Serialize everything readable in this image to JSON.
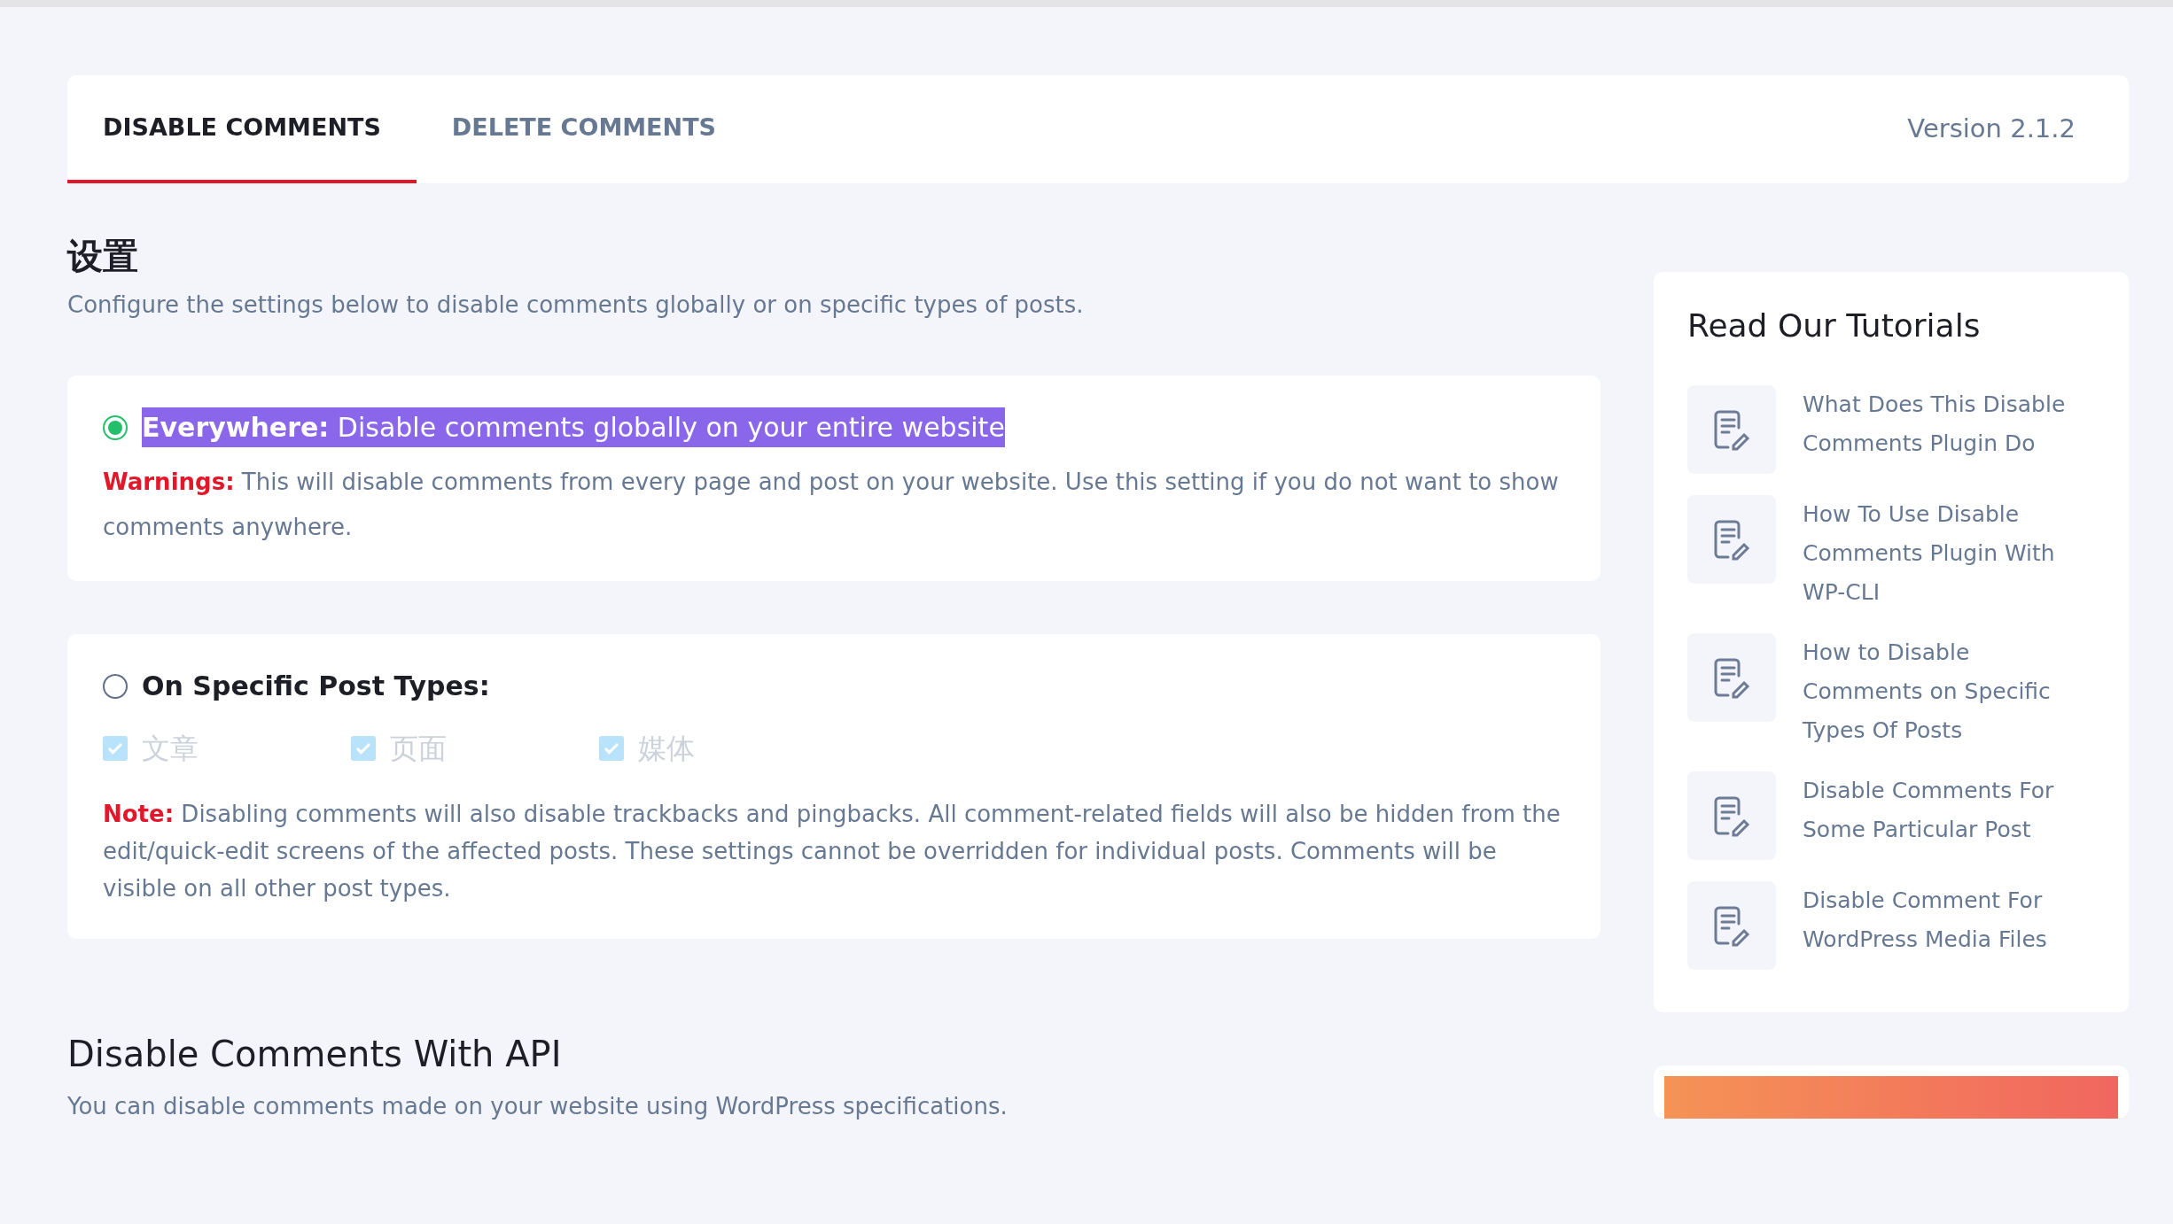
{
  "tabs": [
    {
      "label": "DISABLE COMMENTS",
      "selected": true
    },
    {
      "label": "DELETE COMMENTS",
      "selected": false
    }
  ],
  "version": "Version 2.1.2",
  "settings": {
    "title": "设置",
    "description": "Configure the settings below to disable comments globally or on specific types of posts."
  },
  "options": [
    {
      "kind": "everywhere",
      "selected": true,
      "highlighted": true,
      "label": "**Everywhere:** Disable comments globally on your entire website",
      "warning_label": "Warnings:",
      "warning_text": "This will disable comments from every page and post on your website. Use this setting if you do not want to show comments anywhere."
    },
    {
      "kind": "post_types",
      "selected": false,
      "highlighted": false,
      "label": "On Specific Post Types:",
      "post_types": [
        {
          "label": "文章",
          "checked": true,
          "disabled": true
        },
        {
          "label": "页面",
          "checked": true,
          "disabled": true
        },
        {
          "label": "媒体",
          "checked": true,
          "disabled": true
        }
      ],
      "note_label": "Note:",
      "note_text": "Disabling comments will also disable trackbacks and pingbacks. All comment-related fields will also be hidden from the edit/quick-edit screens of the affected posts. These settings cannot be overridden for individual posts. Comments will be visible on all other post types."
    }
  ],
  "api": {
    "title": "Disable Comments With API",
    "description": "You can disable comments made on your website using WordPress specifications."
  },
  "tutorials": {
    "title": "Read Our Tutorials",
    "items": [
      "What Does This Disable Comments Plugin Do",
      "How To Use Disable Comments Plugin With WP-CLI",
      "How to Disable Comments on Specific Types Of Posts",
      "Disable Comments For Some Particular Post",
      "Disable Comment For WordPress Media Files"
    ]
  }
}
